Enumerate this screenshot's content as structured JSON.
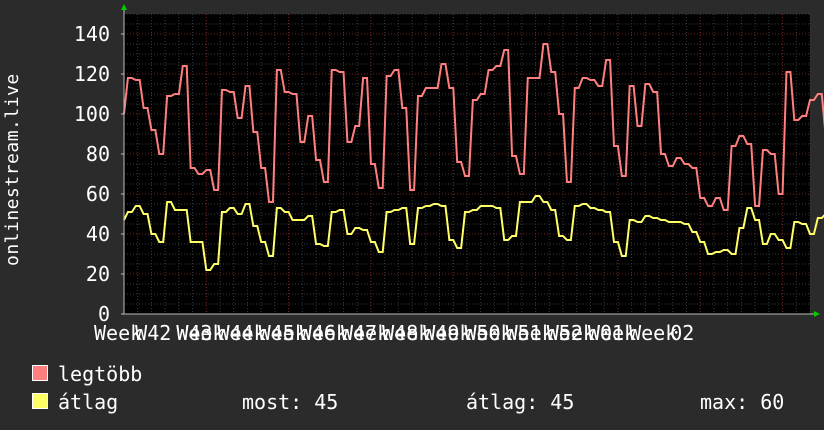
{
  "colors": {
    "background": "#2b2b2b",
    "plot_background": "#000000",
    "grid_major": "#7a2020",
    "grid_minor": "#3a3a3a",
    "axis": "#bbbbbb",
    "arrow": "#00cc00",
    "max_series": "#ff7f7f",
    "avg_series": "#ffff66",
    "text": "#ffffff"
  },
  "chart_data": {
    "type": "line",
    "ylabel": "onlinestream.live",
    "ylim": [
      0,
      150
    ],
    "yticks": [
      0,
      20,
      40,
      60,
      80,
      100,
      120,
      140
    ],
    "xlim": [
      0,
      175
    ],
    "xticks": [
      {
        "label": "Week",
        "x": 0
      },
      {
        "label": "W42",
        "x": 10.5
      },
      {
        "label": "Week",
        "x": 21
      },
      {
        "label": "W43",
        "x": 21
      },
      {
        "label": "Week",
        "x": 31.5
      },
      {
        "label": "W44",
        "x": 31.5
      },
      {
        "label": "Week",
        "x": 42
      },
      {
        "label": "W45",
        "x": 42
      },
      {
        "label": "Week",
        "x": 52.5
      },
      {
        "label": "W46",
        "x": 52.5
      },
      {
        "label": "Week",
        "x": 63
      },
      {
        "label": "W47",
        "x": 63
      },
      {
        "label": "Week",
        "x": 73.5
      },
      {
        "label": "W48",
        "x": 73.5
      },
      {
        "label": "Week",
        "x": 84
      },
      {
        "label": "W49",
        "x": 84
      },
      {
        "label": "Week",
        "x": 94.5
      },
      {
        "label": "W50",
        "x": 94.5
      },
      {
        "label": "Week",
        "x": 105
      },
      {
        "label": "W51",
        "x": 105
      },
      {
        "label": "Week",
        "x": 115.5
      },
      {
        "label": "W52",
        "x": 115.5
      },
      {
        "label": "Week",
        "x": 126
      },
      {
        "label": "W01",
        "x": 126
      },
      {
        "label": "Week",
        "x": 136.5
      },
      {
        "label": "02",
        "x": 147
      }
    ],
    "series": [
      {
        "name": "legtöbb",
        "color": "#ff7f7f",
        "values": [
          100,
          118,
          118,
          117,
          117,
          103,
          103,
          92,
          92,
          80,
          80,
          109,
          109,
          110,
          110,
          124,
          124,
          73,
          73,
          70,
          70,
          72,
          72,
          62,
          62,
          112,
          112,
          111,
          111,
          98,
          98,
          114,
          114,
          91,
          91,
          73,
          73,
          56,
          56,
          122,
          122,
          111,
          111,
          110,
          110,
          86,
          86,
          99,
          99,
          77,
          77,
          66,
          66,
          122,
          122,
          121,
          121,
          86,
          86,
          94,
          94,
          118,
          118,
          75,
          75,
          63,
          63,
          119,
          119,
          122,
          122,
          103,
          103,
          62,
          62,
          109,
          109,
          113,
          113,
          113,
          113,
          125,
          125,
          113,
          113,
          76,
          76,
          69,
          69,
          107,
          107,
          110,
          110,
          122,
          122,
          124,
          124,
          132,
          132,
          79,
          79,
          70,
          70,
          118,
          118,
          118,
          118,
          135,
          135,
          121,
          121,
          100,
          100,
          66,
          66,
          113,
          113,
          118,
          118,
          117,
          117,
          114,
          114,
          127,
          127,
          84,
          84,
          69,
          69,
          114,
          114,
          94,
          94,
          115,
          115,
          111,
          111,
          80,
          80,
          74,
          74,
          78,
          78,
          75,
          75,
          73,
          73,
          58,
          58,
          54,
          54,
          58,
          58,
          52,
          52,
          84,
          84,
          89,
          89,
          85,
          85,
          54,
          54,
          82,
          82,
          80,
          80,
          60,
          60,
          121,
          121,
          97,
          97,
          99,
          99,
          107,
          107,
          110,
          110,
          89,
          89,
          65,
          65,
          99
        ]
      },
      {
        "name": "átlag",
        "color": "#ffff66",
        "values": [
          47,
          51,
          51,
          54,
          54,
          50,
          50,
          40,
          40,
          36,
          36,
          56,
          56,
          52,
          52,
          52,
          52,
          36,
          36,
          36,
          36,
          22,
          22,
          25,
          25,
          51,
          51,
          53,
          53,
          50,
          50,
          55,
          55,
          44,
          44,
          36,
          36,
          29,
          29,
          53,
          53,
          51,
          51,
          47,
          47,
          47,
          47,
          49,
          49,
          35,
          35,
          34,
          34,
          51,
          51,
          52,
          52,
          40,
          40,
          43,
          43,
          42,
          42,
          36,
          36,
          31,
          31,
          51,
          51,
          52,
          52,
          53,
          53,
          35,
          35,
          53,
          53,
          54,
          54,
          55,
          55,
          54,
          54,
          37,
          37,
          33,
          33,
          51,
          51,
          52,
          52,
          54,
          54,
          54,
          54,
          53,
          53,
          37,
          37,
          39,
          39,
          56,
          56,
          56,
          56,
          59,
          59,
          56,
          56,
          52,
          52,
          39,
          39,
          37,
          37,
          54,
          54,
          55,
          55,
          53,
          53,
          52,
          52,
          51,
          51,
          36,
          36,
          29,
          29,
          47,
          47,
          46,
          46,
          49,
          49,
          48,
          48,
          47,
          47,
          46,
          46,
          46,
          46,
          45,
          45,
          41,
          41,
          36,
          36,
          30,
          30,
          31,
          31,
          32,
          32,
          30,
          30,
          43,
          43,
          53,
          53,
          47,
          47,
          35,
          35,
          40,
          40,
          37,
          37,
          33,
          33,
          46,
          46,
          45,
          45,
          40,
          40,
          48,
          48,
          50,
          50,
          39,
          39,
          32,
          32,
          44
        ]
      }
    ]
  },
  "legend": [
    {
      "label": "legtöbb",
      "color": "#ff7f7f"
    },
    {
      "label": "átlag",
      "color": "#ffff66"
    }
  ],
  "stats": {
    "now": "most: 45",
    "avg": "átlag: 45",
    "max": "max: 60"
  }
}
